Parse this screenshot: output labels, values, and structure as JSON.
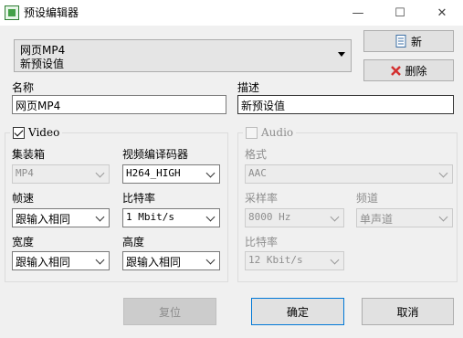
{
  "window": {
    "title": "预设编辑器",
    "min": "—",
    "max": "☐",
    "close": "✕"
  },
  "preset_combo": {
    "line1": "网页MP4",
    "line2": "新预设值"
  },
  "buttons": {
    "new": "新",
    "delete": "删除",
    "reset": "复位",
    "ok": "确定",
    "cancel": "取消"
  },
  "name": {
    "label": "名称",
    "value": "网页MP4"
  },
  "description": {
    "label": "描述",
    "value": "新预设值"
  },
  "video": {
    "legend": "Video",
    "enabled": true,
    "container": {
      "label": "集装箱",
      "value": "MP4"
    },
    "codec": {
      "label": "视频编译码器",
      "value": "H264_HIGH"
    },
    "framerate": {
      "label": "帧速",
      "value": "跟输入相同"
    },
    "bitrate": {
      "label": "比特率",
      "value": "1 Mbit/s"
    },
    "width": {
      "label": "宽度",
      "value": "跟输入相同"
    },
    "height": {
      "label": "高度",
      "value": "跟输入相同"
    }
  },
  "audio": {
    "legend": "Audio",
    "enabled": false,
    "format": {
      "label": "格式",
      "value": "AAC"
    },
    "samplerate": {
      "label": "采样率",
      "value": "8000 Hz"
    },
    "channels": {
      "label": "频道",
      "value": "单声道"
    },
    "bitrate": {
      "label": "比特率",
      "value": "12 Kbit/s"
    }
  }
}
